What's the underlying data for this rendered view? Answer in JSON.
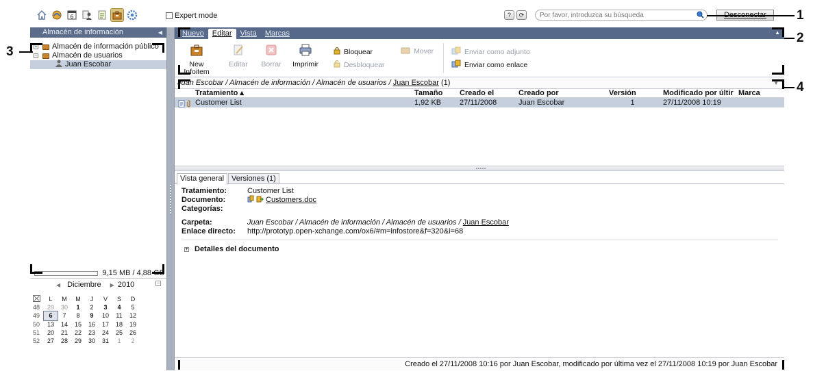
{
  "topbar": {
    "icons": [
      "home-icon",
      "portal-icon",
      "calendar-icon",
      "contacts-icon",
      "tasks-icon",
      "infostore-icon",
      "settings-icon"
    ],
    "calendar_day": "6",
    "expert_mode_label": "Expert mode",
    "help_label": "?",
    "refresh_label": "⟳",
    "search_placeholder": "Por favor, introduzca su búsqueda",
    "logout_label": "Desconectar"
  },
  "sidebar": {
    "title": "Almacén de información",
    "tree": [
      {
        "label": "Almacén de información público",
        "expander": "+"
      },
      {
        "label": "Almacén de usuarios",
        "expander": "−"
      },
      {
        "label": "Juan Escobar"
      }
    ],
    "quota": "9,15 MB / 4,88 GB"
  },
  "calendar": {
    "month": "Diciembre",
    "year": "2010",
    "weekday_headers": [
      "L",
      "M",
      "M",
      "J",
      "V",
      "S",
      "D"
    ],
    "weeks": [
      {
        "wk": "48",
        "days": [
          "29",
          "30",
          "1",
          "2",
          "3",
          "4",
          "5"
        ]
      },
      {
        "wk": "49",
        "days": [
          "6",
          "7",
          "8",
          "9",
          "10",
          "11",
          "12"
        ]
      },
      {
        "wk": "50",
        "days": [
          "13",
          "14",
          "15",
          "16",
          "17",
          "18",
          "19"
        ]
      },
      {
        "wk": "51",
        "days": [
          "20",
          "21",
          "22",
          "23",
          "24",
          "25",
          "26"
        ]
      },
      {
        "wk": "52",
        "days": [
          "27",
          "28",
          "29",
          "30",
          "31",
          "1",
          "2"
        ]
      }
    ]
  },
  "tabs": {
    "nuevo": "Nuevo",
    "editar": "Editar",
    "vista": "Vista",
    "marcas": "Marcas"
  },
  "ribbon": {
    "new_line1": "New",
    "new_line2": "Infoitem",
    "edit": "Editar",
    "delete": "Borrar",
    "print": "Imprimir",
    "lock": "Bloquear",
    "unlock": "Desbloquear",
    "move": "Mover",
    "send_attachment": "Enviar como adjunto",
    "send_link": "Enviar como enlace"
  },
  "path": {
    "text": "Juan Escobar / Almacén de información / Almacén de usuarios /",
    "link": "Juan Escobar",
    "count": "(1)"
  },
  "grid": {
    "columns": [
      "Tratamiento ▴",
      "Tamaño",
      "Creado el",
      "Creado por",
      "Versión",
      "Modificado por últir",
      "Marca"
    ],
    "rows": [
      [
        "Customer List",
        "1,92 KB",
        "27/11/2008",
        "Juan Escobar",
        "1",
        "27/11/2008 10:19"
      ]
    ]
  },
  "detail": {
    "tab_overview": "Vista general",
    "tab_versions": "Versiones (1)",
    "labels": {
      "treatment": "Tratamiento:",
      "document": "Documento:",
      "categories": "Categorías:",
      "folder": "Carpeta:",
      "link": "Enlace directo:"
    },
    "treatment": "Customer List",
    "document": "Customers.doc",
    "folder_text": "Juan Escobar / Almacén de información / Almacén de usuarios /",
    "folder_link": "Juan Escobar",
    "direct_link": "http://prototyp.open-xchange.com/ox6/#m=infostore&f=320&i=68",
    "details_label": "Detalles del documento"
  },
  "status": "Creado el 27/11/2008 10:16 por Juan Escobar, modificado por última vez el 27/11/2008 10:19 por Juan Escobar",
  "callouts": [
    "1",
    "2",
    "3",
    "4"
  ],
  "colors": {
    "header": "#56698a",
    "selection": "#c6cfdd",
    "splitter": "#a9b1bf"
  }
}
